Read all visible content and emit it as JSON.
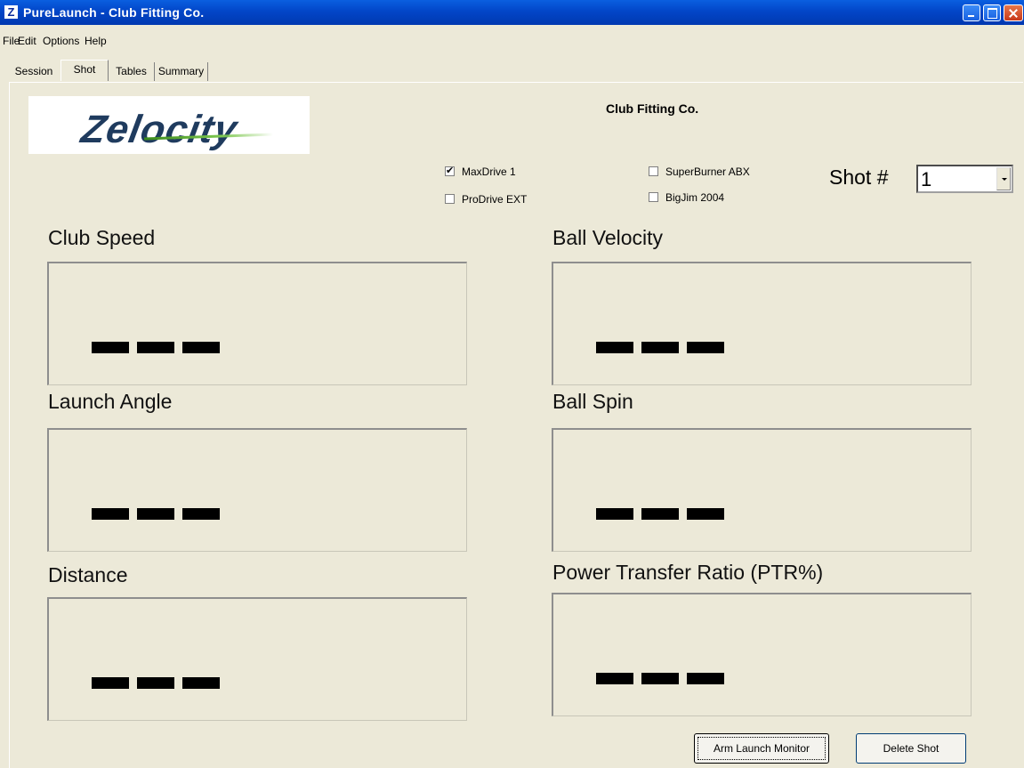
{
  "window": {
    "title": "PureLaunch - Club Fitting Co."
  },
  "menu": [
    "File",
    "Edit",
    "Options",
    "Help"
  ],
  "tabs": [
    {
      "label": "Session",
      "selected": false
    },
    {
      "label": "Shot",
      "selected": true
    },
    {
      "label": "Tables",
      "selected": false
    },
    {
      "label": "Summary",
      "selected": false
    }
  ],
  "logo": {
    "text": "Zelocity"
  },
  "company_name": "Club Fitting Co.",
  "clubs": [
    {
      "label": "MaxDrive 1",
      "checked": true
    },
    {
      "label": "ProDrive EXT",
      "checked": false
    },
    {
      "label": "SuperBurner ABX",
      "checked": false
    },
    {
      "label": "BigJim 2004",
      "checked": false
    }
  ],
  "shot": {
    "label": "Shot #",
    "value": "1"
  },
  "metrics": {
    "club_speed": {
      "label": "Club Speed",
      "value": "---"
    },
    "ball_velocity": {
      "label": "Ball Velocity",
      "value": "---"
    },
    "launch_angle": {
      "label": "Launch Angle",
      "value": "---"
    },
    "ball_spin": {
      "label": "Ball Spin",
      "value": "---"
    },
    "distance": {
      "label": "Distance",
      "value": "---"
    },
    "ptr": {
      "label": "Power Transfer Ratio (PTR%)",
      "value": "---"
    }
  },
  "buttons": {
    "arm": "Arm Launch Monitor",
    "delete": "Delete Shot"
  },
  "colors": {
    "titlebar": "#0246c8",
    "background": "#ece9d8",
    "close": "#c8391a"
  }
}
